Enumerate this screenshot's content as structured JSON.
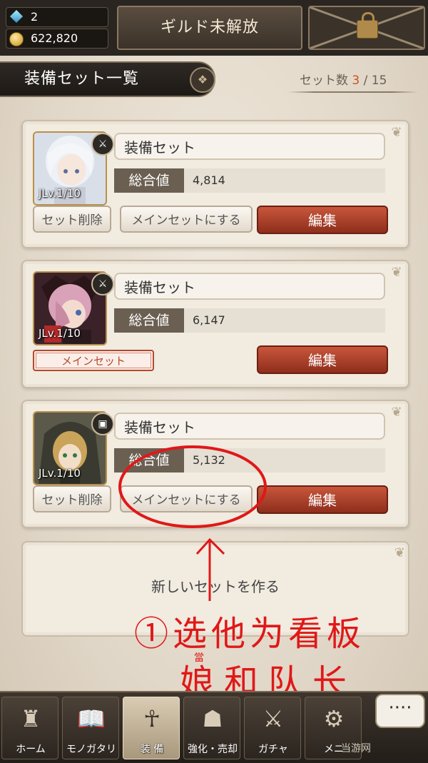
{
  "header": {
    "gems": "2",
    "gold": "622,820",
    "guild_label": "ギルド未解放"
  },
  "title": {
    "text": "装備セット一覧",
    "emblem": "❖",
    "count_label": "セット数",
    "count_current": "3",
    "count_separator": "/",
    "count_max": "15"
  },
  "sets": [
    {
      "name": "装備セット",
      "stat_label": "総合値",
      "stat_value": "4,814",
      "level": "JLv.1/10",
      "weapon_icon": "sword-icon",
      "is_main": false,
      "delete_label": "セット削除",
      "make_main_label": "メインセットにする",
      "edit_label": "編集"
    },
    {
      "name": "装備セット",
      "stat_label": "総合値",
      "stat_value": "6,147",
      "level": "JLv.1/10",
      "weapon_icon": "sword-icon",
      "is_main": true,
      "main_tag_label": "メインセット",
      "edit_label": "編集"
    },
    {
      "name": "装備セット",
      "stat_label": "総合値",
      "stat_value": "5,132",
      "level": "JLv.1/10",
      "weapon_icon": "book-icon",
      "is_main": false,
      "delete_label": "セット削除",
      "make_main_label": "メインセットにする",
      "edit_label": "編集"
    }
  ],
  "new_set_label": "新しいセットを作る",
  "annotation": {
    "line1": "①选他为看板",
    "line2": "娘和队长",
    "small": "當",
    "color": "#e01818"
  },
  "nav": [
    {
      "label": "ホーム",
      "icon": "castle-icon"
    },
    {
      "label": "モノガタリ",
      "icon": "book-icon"
    },
    {
      "label": "装 備",
      "icon": "puppet-icon",
      "active": true
    },
    {
      "label": "強化・売却",
      "icon": "mask-icon"
    },
    {
      "label": "ガチャ",
      "icon": "swords-icon"
    },
    {
      "label": "メニ",
      "icon": "gears-icon"
    }
  ],
  "chat_label": "····",
  "watermark": "当游网"
}
